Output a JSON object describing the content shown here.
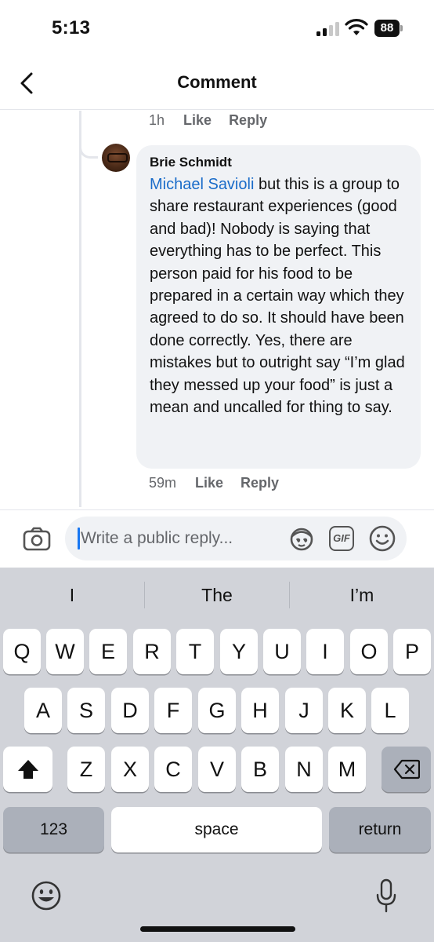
{
  "status_bar": {
    "time": "5:13",
    "battery": "88"
  },
  "header": {
    "title": "Comment"
  },
  "thread": {
    "previous_meta": {
      "time": "1h",
      "like": "Like",
      "reply": "Reply"
    },
    "comment": {
      "author": "Brie Schmidt",
      "mention": "Michael Savioli",
      "text": " but this is a group to share restaurant experiences (good and bad)! Nobody is saying that everything has to be perfect. This person paid for his food to be prepared in a certain way which they agreed to do so. It should have been done correctly. Yes, there are mistakes but to outright say “I’m glad they messed up your food” is just a mean and uncalled for thing to say.",
      "time": "59m",
      "like": "Like",
      "reply": "Reply"
    }
  },
  "reply_bar": {
    "placeholder": "Write a public reply...",
    "gif_label": "GIF"
  },
  "keyboard": {
    "suggestions": [
      "I",
      "The",
      "I’m"
    ],
    "row1": [
      "Q",
      "W",
      "E",
      "R",
      "T",
      "Y",
      "U",
      "I",
      "O",
      "P"
    ],
    "row2": [
      "A",
      "S",
      "D",
      "F",
      "G",
      "H",
      "J",
      "K",
      "L"
    ],
    "row3": [
      "Z",
      "X",
      "C",
      "V",
      "B",
      "N",
      "M"
    ],
    "numbers_key": "123",
    "space_key": "space",
    "return_key": "return"
  },
  "icons": {
    "back": "chevron-left-icon",
    "camera": "camera-icon",
    "avatar_sticker": "avatar-sticker-icon",
    "emoji": "smiley-icon",
    "shift": "shift-arrow-icon",
    "delete": "backspace-icon",
    "mic": "microphone-icon"
  },
  "colors": {
    "mention": "#1a6cc9",
    "caret": "#1877f2",
    "bubble": "#f0f2f5",
    "keyboard_bg": "#d1d3d9"
  }
}
